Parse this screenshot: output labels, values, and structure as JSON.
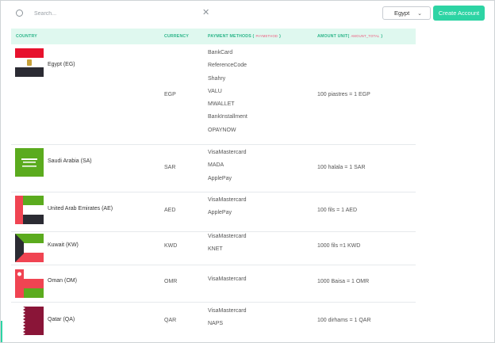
{
  "search": {
    "placeholder": "Search..."
  },
  "filter": {
    "selected": "Egypt"
  },
  "actions": {
    "create_label": "Create Account"
  },
  "table": {
    "headers": {
      "country": "COUNTRY",
      "currency": "CURRENCY",
      "methods": "PAYMENT METHODS (",
      "methods_tag": "PAYMETHOD",
      "methods_close": ")",
      "amount": "AMOUNT UNIT(",
      "amount_tag": "AMOUNT_TOTAL",
      "amount_close": ")"
    },
    "rows": [
      {
        "country": "Egypt (EG)",
        "currency": "EGP",
        "methods": [
          "BankCard",
          "ReferenceCode",
          "Shahry",
          "VALU",
          "MWALLET",
          "BankInstallment",
          "OPAYNOW"
        ],
        "amount": "100 piastres = 1 EGP"
      },
      {
        "country": "Saudi Arabia (SA)",
        "currency": "SAR",
        "methods": [
          "VisaMastercard",
          "MADA",
          "ApplePay"
        ],
        "amount": "100 halala = 1 SAR"
      },
      {
        "country": "United Arab Emirates (AE)",
        "currency": "AED",
        "methods": [
          "VisaMastercard",
          "ApplePay"
        ],
        "amount": "100 fils = 1 AED"
      },
      {
        "country": "Kuwait (KW)",
        "currency": "KWD",
        "methods": [
          "VisaMastercard",
          "KNET"
        ],
        "amount": "1000 fils =1 KWD"
      },
      {
        "country": "Oman (OM)",
        "currency": "OMR",
        "methods": [
          "VisaMastercard"
        ],
        "amount": "1000 Baisa = 1 OMR"
      },
      {
        "country": "Qatar (QA)",
        "currency": "QAR",
        "methods": [
          "VisaMastercard",
          "NAPS"
        ],
        "amount": "100 dirhams = 1 QAR"
      }
    ]
  },
  "colors": {
    "accent": "#2dd4a4",
    "header_bg": "#dff8ef",
    "header_text": "#2bb589",
    "tag": "#f0557a"
  },
  "icons": {
    "search": "search-icon",
    "clear": "close-icon",
    "chevron": "chevron-down-icon"
  }
}
